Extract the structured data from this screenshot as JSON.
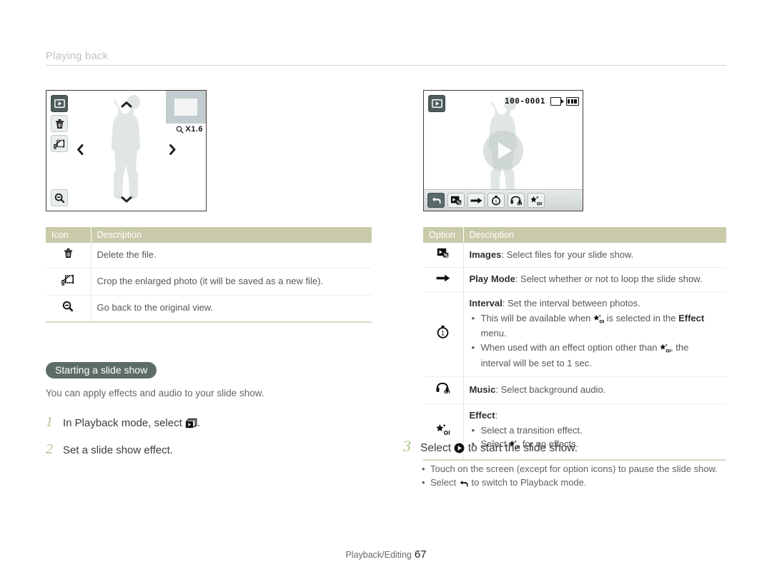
{
  "header": {
    "title": "Playing back"
  },
  "left_screen": {
    "zoom_label": "X1.6",
    "buttons": [
      {
        "name": "playback-mode-icon",
        "label": "Playback"
      },
      {
        "name": "trash-icon",
        "label": "Delete"
      },
      {
        "name": "crop-film-icon",
        "label": "Crop"
      },
      {
        "name": "zoom-out-icon",
        "label": "Zoom out"
      }
    ],
    "nav": {
      "up": "⌃",
      "down": "⌄",
      "left": "‹",
      "right": "›"
    }
  },
  "right_screen": {
    "file_number": "100-0001",
    "icons": {
      "card": "memory-card-icon",
      "battery": "battery-icon"
    },
    "toolbar": [
      {
        "name": "back-icon",
        "label": "Back"
      },
      {
        "name": "images-icon",
        "label": "Images"
      },
      {
        "name": "play-mode-arrow-icon",
        "label": "Play Mode"
      },
      {
        "name": "interval-stopwatch-icon",
        "label": "Interval"
      },
      {
        "name": "music-off-icon",
        "label": "Music Off"
      },
      {
        "name": "effect-off-icon",
        "label": "Effect Off"
      }
    ]
  },
  "left_table": {
    "headers": {
      "icon": "Icon",
      "description": "Description"
    },
    "rows": [
      {
        "icon": "trash-icon",
        "description": "Delete the file."
      },
      {
        "icon": "crop-film-icon",
        "description": "Crop the enlarged photo (it will be saved as a new file)."
      },
      {
        "icon": "zoom-out-icon",
        "description": "Go back to the original view."
      }
    ]
  },
  "slide_show": {
    "badge": "Starting a slide show",
    "lede": "You can apply effects and audio to your slide show.",
    "steps": [
      {
        "num": "1",
        "pre": "In Playback mode, select ",
        "icon": "slide-show-icon",
        "post": "."
      },
      {
        "num": "2",
        "pre": "Set a slide show effect.",
        "icon": "",
        "post": ""
      }
    ]
  },
  "right_table": {
    "headers": {
      "option": "Option",
      "description": "Description"
    },
    "rows": [
      {
        "icon": "images-icon",
        "title": "Images",
        "text": ": Select files for your slide show.",
        "bullets": []
      },
      {
        "icon": "play-mode-arrow-icon",
        "title": "Play Mode",
        "text": ": Select whether or not to loop the slide show.",
        "bullets": []
      },
      {
        "icon": "interval-stopwatch-icon",
        "title": "Interval",
        "text": ": Set the interval between photos.",
        "bullets": [
          {
            "a": "This will be available when ",
            "icon": "effect-off-icon",
            "b": " is selected in the ",
            "bold": "Effect",
            "c": " menu."
          },
          {
            "a": "When used with an effect option other than ",
            "icon": "effect-off-icon",
            "b": ", the interval will be set to 1 sec.",
            "bold": "",
            "c": ""
          }
        ]
      },
      {
        "icon": "music-off-icon",
        "title": "Music",
        "text": ": Select background audio.",
        "bullets": []
      },
      {
        "icon": "effect-off-icon",
        "title": "Effect",
        "text": ":",
        "bullets": [
          {
            "a": "Select a transition effect.",
            "icon": "",
            "b": "",
            "bold": "",
            "c": ""
          },
          {
            "a": "Select ",
            "icon": "effect-off-icon",
            "b": " for no effects.",
            "bold": "",
            "c": ""
          }
        ]
      }
    ]
  },
  "final_step": {
    "num": "3",
    "pre": "Select ",
    "icon": "play-circle-icon",
    "post": " to start the slide show.",
    "bullets": [
      {
        "a": "Touch on the screen (except for option icons) to pause the slide show.",
        "icon": "",
        "b": ""
      },
      {
        "a": "Select ",
        "icon": "back-icon",
        "b": " to switch to Playback mode."
      }
    ]
  },
  "footer": {
    "section": "Playback/Editing",
    "page": "67"
  },
  "colors": {
    "table_header": "#c9caa9",
    "badge": "#5d6c68",
    "step_number": "#adc68f",
    "table_bottom_rule": "#cfdcc7",
    "header_text": "#bfc4c2"
  }
}
